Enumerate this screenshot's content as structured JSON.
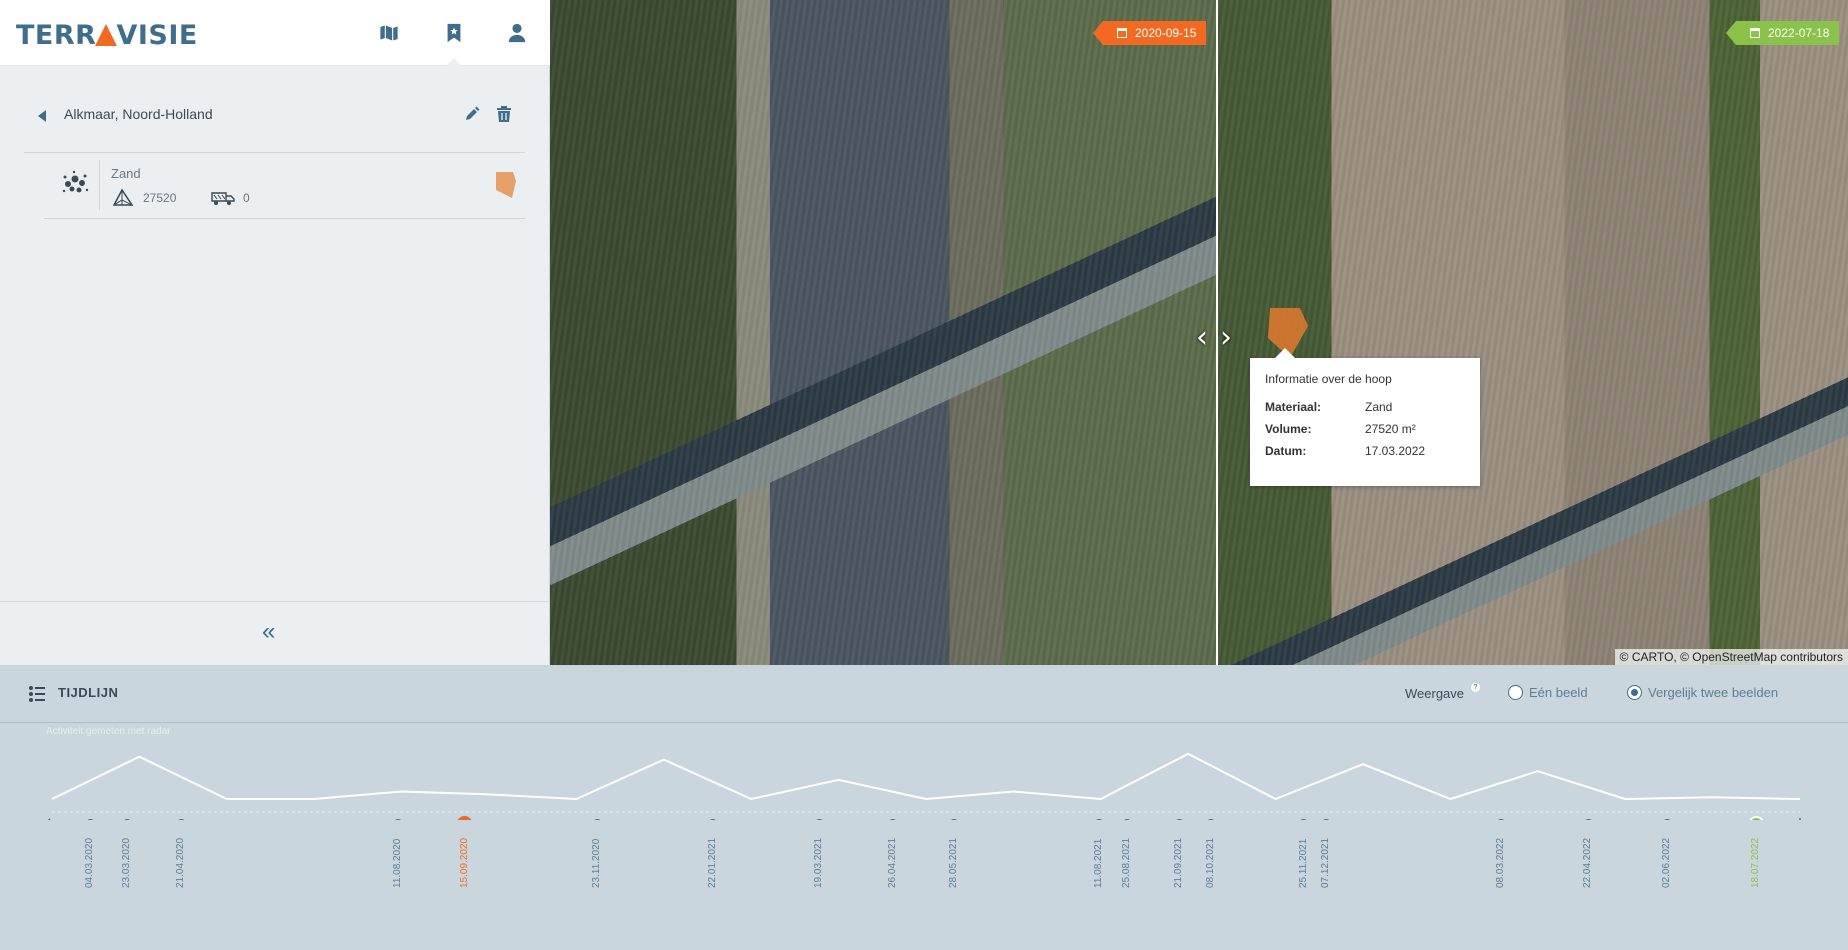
{
  "app": {
    "logo_pre": "TERR",
    "logo_post": "VISIE"
  },
  "nav": {
    "icons": [
      "map-icon",
      "bookmark-star-icon",
      "user-icon"
    ]
  },
  "location": {
    "title": "Alkmaar, Noord-Holland"
  },
  "pile": {
    "material": "Zand",
    "volume": "27520",
    "trucks": "0",
    "shape_color": "#e8a06a"
  },
  "map": {
    "left_date": "2020-09-15",
    "right_date": "2022-07-18",
    "left_tag_color": "#f26a21",
    "right_tag_color": "#8bc34a",
    "popup": {
      "title": "Informatie over de hoop",
      "material_label": "Materiaal:",
      "material": "Zand",
      "volume_label": "Volume:",
      "volume": "27520 m²",
      "date_label": "Datum:",
      "date": "17.03.2022"
    },
    "attribution": "© CARTO, © OpenStreetMap contributors"
  },
  "timeline": {
    "title": "TIJDLIJN",
    "caption": "Activiteit gemeten met radar",
    "view_label": "Weergave",
    "help": "?",
    "option_single": "Eén beeld",
    "option_compare": "Vergelijk twee beelden",
    "selected_option": "compare",
    "dates": [
      {
        "label": "04.03.2020",
        "t": 0.022,
        "state": "open"
      },
      {
        "label": "23.03.2020",
        "t": 0.043,
        "state": "open"
      },
      {
        "label": "21.04.2020",
        "t": 0.074,
        "state": "filled"
      },
      {
        "label": "11.08.2020",
        "t": 0.198,
        "state": "filled"
      },
      {
        "label": "15.09.2020",
        "t": 0.236,
        "state": "left-selected"
      },
      {
        "label": "23.11.2020",
        "t": 0.312,
        "state": "filled"
      },
      {
        "label": "22.01.2021",
        "t": 0.378,
        "state": "filled"
      },
      {
        "label": "19.03.2021",
        "t": 0.439,
        "state": "filled"
      },
      {
        "label": "26.04.2021",
        "t": 0.481,
        "state": "open"
      },
      {
        "label": "28.05.2021",
        "t": 0.516,
        "state": "open"
      },
      {
        "label": "11.08.2021",
        "t": 0.599,
        "state": "filled"
      },
      {
        "label": "25.08.2021",
        "t": 0.615,
        "state": "open"
      },
      {
        "label": "21.09.2021",
        "t": 0.645,
        "state": "filled"
      },
      {
        "label": "08.10.2021",
        "t": 0.663,
        "state": "filled"
      },
      {
        "label": "25.11.2021",
        "t": 0.716,
        "state": "filled"
      },
      {
        "label": "07.12.2021",
        "t": 0.729,
        "state": "filled"
      },
      {
        "label": "08.03.2022",
        "t": 0.829,
        "state": "filled"
      },
      {
        "label": "22.04.2022",
        "t": 0.879,
        "state": "filled"
      },
      {
        "label": "02.06.2022",
        "t": 0.924,
        "state": "filled"
      },
      {
        "label": "18.07.2022",
        "t": 0.975,
        "state": "right-selected"
      }
    ],
    "activity": [
      0.12,
      0.85,
      0.12,
      0.12,
      0.25,
      0.2,
      0.12,
      0.8,
      0.12,
      0.45,
      0.12,
      0.25,
      0.12,
      0.9,
      0.12,
      0.72,
      0.12,
      0.6,
      0.12,
      0.15,
      0.12
    ],
    "colors": {
      "line": "#3f6e8c",
      "left": "#f26a21",
      "right": "#8bc34a"
    }
  }
}
